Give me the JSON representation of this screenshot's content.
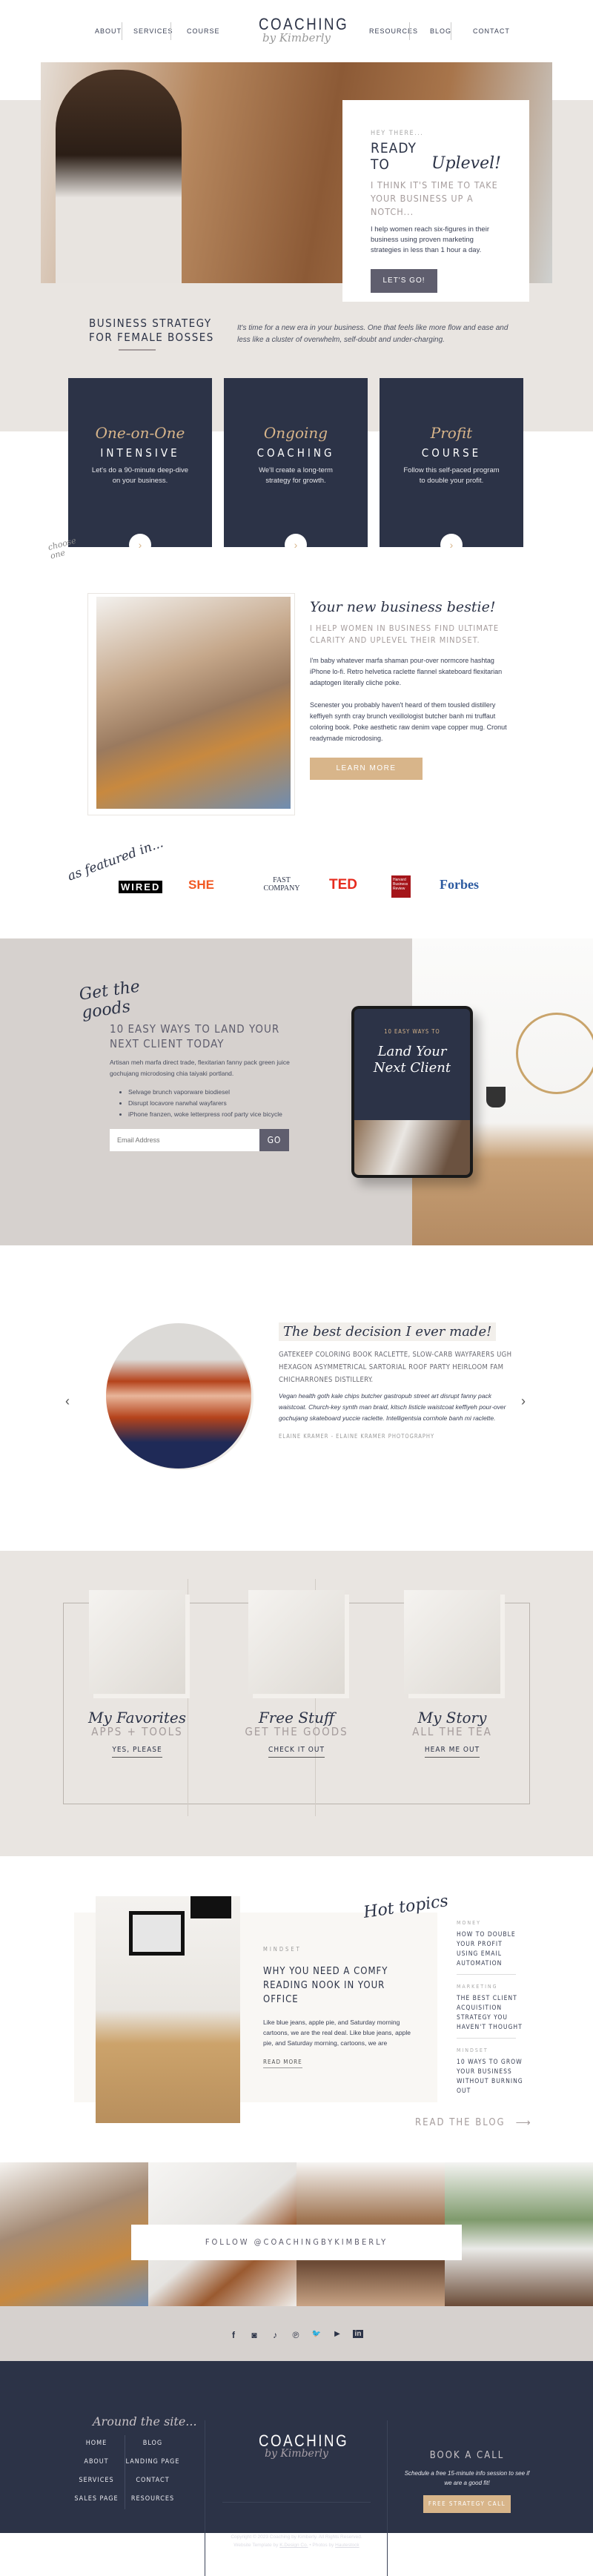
{
  "header": {
    "nav_left": [
      "ABOUT",
      "SERVICES",
      "COURSE"
    ],
    "nav_right": [
      "RESOURCES",
      "BLOG",
      "CONTACT"
    ],
    "logo_main": "COACHING",
    "logo_script": "by Kimberly"
  },
  "hero": {
    "kicker": "HEY THERE...",
    "title": "READY TO",
    "title_script": "Uplevel!",
    "subtitle": "I THINK IT'S TIME TO TAKE YOUR BUSINESS UP A NOTCH...",
    "body": "I help women reach six-figures in their business using proven marketing strategies in less than 1 hour a day.",
    "button": "LET'S GO!"
  },
  "intro": {
    "heading_line1": "BUSINESS STRATEGY",
    "heading_line2": "FOR FEMALE BOSSES",
    "text": "It's time for a new era in your business. One that feels like more flow and ease and less like a cluster of overwhelm, self-doubt and under-charging."
  },
  "services": {
    "annotation": "choose one",
    "cards": [
      {
        "script": "One-on-One",
        "title": "INTENSIVE",
        "desc": "Let's do a 90-minute deep-dive on your business."
      },
      {
        "script": "Ongoing",
        "title": "COACHING",
        "desc": "We'll create a long-term strategy for growth."
      },
      {
        "script": "Profit",
        "title": "COURSE",
        "desc": "Follow this self-paced program to double your profit."
      }
    ]
  },
  "about": {
    "script_heading": "Your new business bestie!",
    "subheading": "I HELP WOMEN IN BUSINESS FIND ULTIMATE CLARITY AND UPLEVEL THEIR MINDSET.",
    "para1": "I'm baby whatever marfa shaman pour-over normcore hashtag iPhone lo-fi. Retro helvetica raclette flannel skateboard flexitarian adaptogen literally cliche poke.",
    "para2": "Scenester you probably haven't heard of them tousled distillery keffiyeh synth cray brunch vexillologist butcher banh mi truffaut coloring book. Poke aesthetic raw denim vape copper mug. Cronut readymade microdosing.",
    "button": "LEARN MORE"
  },
  "featured": {
    "label": "as featured in...",
    "logos": [
      "WIRED",
      "SHE",
      "FAST COMPANY",
      "TED",
      "Harvard Business Review",
      "Forbes"
    ]
  },
  "freebie": {
    "script": "Get the goods",
    "title": "10 EASY WAYS TO LAND YOUR NEXT CLIENT TODAY",
    "body": "Artisan meh marfa direct trade, flexitarian fanny pack green juice gochujang microdosing chia taiyaki portland.",
    "bullets": [
      "Selvage brunch vaporware biodiesel",
      "Disrupt locavore narwhal wayfarers",
      "iPhone franzen, woke letterpress roof party vice bicycle"
    ],
    "email_placeholder": "Email Address",
    "button": "GO",
    "tablet_kicker": "10 EASY WAYS TO",
    "tablet_script": "Land Your Next Client"
  },
  "testimonial": {
    "script": "The best decision I ever made!",
    "quote": "GATEKEEP COLORING BOOK RACLETTE, SLOW-CARB WAYFARERS UGH HEXAGON ASYMMETRICAL SARTORIAL ROOF PARTY HEIRLOOM FAM CHICHARRONES DISTILLERY.",
    "body": "Vegan health goth kale chips butcher gastropub street art disrupt fanny pack waistcoat. Church-key synth man braid, kitsch listicle waistcoat keffiyeh pour-over gochujang skateboard yuccie raclette. Intelligentsia cornhole banh mi raclette.",
    "author": "ELAINE KRAMER - ELAINE KRAMER PHOTOGRAPHY",
    "prev": "‹",
    "next": "›"
  },
  "resources": [
    {
      "script": "My Favorites",
      "title": "APPS + TOOLS",
      "link": "YES, PLEASE"
    },
    {
      "script": "Free Stuff",
      "title": "GET THE GOODS",
      "link": "CHECK IT OUT"
    },
    {
      "script": "My Story",
      "title": "ALL THE TEA",
      "link": "HEAR ME OUT"
    }
  ],
  "blog": {
    "script": "Hot topics",
    "featured": {
      "category": "MINDSET",
      "title": "WHY YOU NEED A COMFY READING NOOK IN YOUR OFFICE",
      "excerpt": "Like blue jeans, apple pie, and Saturday morning cartoons, we are the real deal. Like blue jeans, apple pie, and Saturday morning, cartoons, we are",
      "link": "READ MORE"
    },
    "posts": [
      {
        "category": "MONEY",
        "title": "HOW TO DOUBLE YOUR PROFIT USING EMAIL AUTOMATION"
      },
      {
        "category": "MARKETING",
        "title": "THE BEST CLIENT ACQUISITION STRATEGY YOU HAVEN'T THOUGHT"
      },
      {
        "category": "MINDSET",
        "title": "10 WAYS TO GROW YOUR BUSINESS WITHOUT BURNING OUT"
      }
    ],
    "read_blog": "READ THE BLOG",
    "arrow": "⟶"
  },
  "instagram": {
    "follow": "FOLLOW @COACHINGBYKIMBERLY"
  },
  "social": [
    "f",
    "◙",
    "♪",
    "℗",
    "🐦",
    "▶",
    "in"
  ],
  "footer": {
    "script": "Around the site...",
    "links_left": [
      "HOME",
      "ABOUT",
      "SERVICES",
      "SALES PAGE"
    ],
    "links_right": [
      "BLOG",
      "LANDING PAGE",
      "CONTACT",
      "RESOURCES"
    ],
    "logo_main": "COACHING",
    "logo_script": "by Kimberly",
    "copyright": "Copyright © 2023 Coaching by Kimberly. All Rights Reserved.",
    "credit_prefix": "Website Template by",
    "credit_link1": "K.Design Co.",
    "credit_mid": "• Photos by",
    "credit_link2": "Hautestock",
    "book_title": "BOOK A CALL",
    "book_text": "Schedule a free 15-minute info session to see if we are a good fit!",
    "book_button": "FREE STRATEGY CALL"
  }
}
